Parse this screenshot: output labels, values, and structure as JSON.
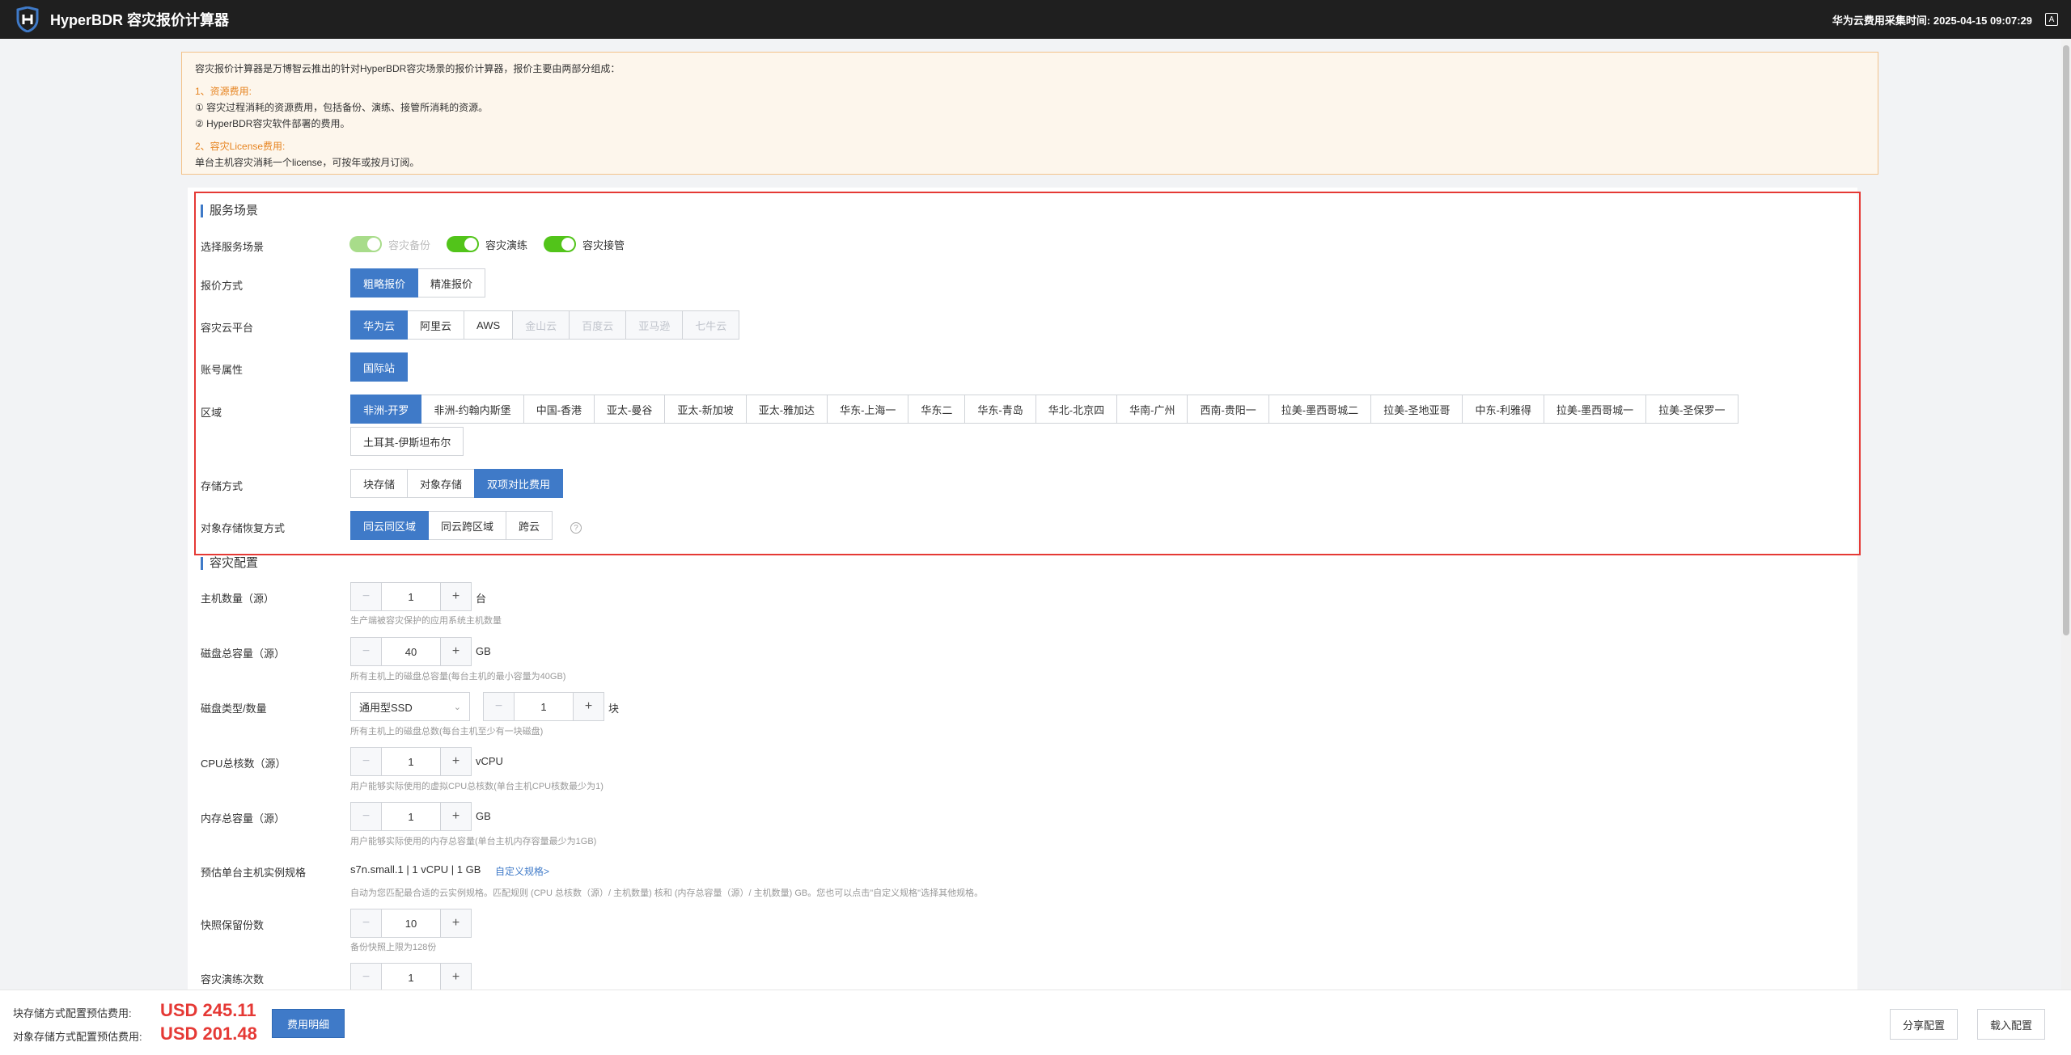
{
  "header": {
    "title": "HyperBDR 容灾报价计算器",
    "collect_time": "华为云费用采集时间: 2025-04-15 09:07:29",
    "corner_icon": "A"
  },
  "notice": {
    "intro": "容灾报价计算器是万博智云推出的针对HyperBDR容灾场景的报价计算器，报价主要由两部分组成：",
    "section1_title": "1、资源费用:",
    "section1_item1": "① 容灾过程消耗的资源费用，包括备份、演练、接管所消耗的资源。",
    "section1_item2": "② HyperBDR容灾软件部署的费用。",
    "section2_title": "2、容灾License费用:",
    "section2_item1": "单台主机容灾消耗一个license，可按年或按月订阅。"
  },
  "service": {
    "section_title": "服务场景",
    "scene_label": "选择服务场景",
    "toggles": [
      {
        "label": "容灾备份",
        "on": true,
        "disabled": true
      },
      {
        "label": "容灾演练",
        "on": true,
        "disabled": false
      },
      {
        "label": "容灾接管",
        "on": true,
        "disabled": false
      }
    ],
    "quote_label": "报价方式",
    "quote_options": [
      "粗略报价",
      "精准报价"
    ],
    "cloud_label": "容灾云平台",
    "cloud_options": [
      "华为云",
      "阿里云",
      "AWS",
      "金山云",
      "百度云",
      "亚马逊",
      "七牛云"
    ],
    "account_label": "账号属性",
    "account_options": [
      "国际站"
    ],
    "region_label": "区域",
    "region_options": [
      "非洲-开罗",
      "非洲-约翰内斯堡",
      "中国-香港",
      "亚太-曼谷",
      "亚太-新加坡",
      "亚太-雅加达",
      "华东-上海一",
      "华东二",
      "华东-青岛",
      "华北-北京四",
      "华南-广州",
      "西南-贵阳一",
      "拉美-墨西哥城二",
      "拉美-圣地亚哥",
      "中东-利雅得",
      "拉美-墨西哥城一",
      "拉美-圣保罗一"
    ],
    "region_options_row2": [
      "土耳其-伊斯坦布尔"
    ],
    "storage_label": "存储方式",
    "storage_options": [
      "块存储",
      "对象存储",
      "双项对比费用"
    ],
    "recovery_label": "对象存储恢复方式",
    "recovery_options": [
      "同云同区域",
      "同云跨区域",
      "跨云"
    ],
    "help_icon": "?"
  },
  "config": {
    "section_title": "容灾配置",
    "hosts": {
      "label": "主机数量（源）",
      "value": "1",
      "unit": "台",
      "hint": "生产端被容灾保护的应用系统主机数量"
    },
    "disk_capacity": {
      "label": "磁盘总容量（源）",
      "value": "40",
      "unit": "GB",
      "hint": "所有主机上的磁盘总容量(每台主机的最小容量为40GB)"
    },
    "disk_type": {
      "label": "磁盘类型/数量",
      "select": "通用型SSD",
      "value": "1",
      "unit": "块",
      "hint": "所有主机上的磁盘总数(每台主机至少有一块磁盘)"
    },
    "cpu": {
      "label": "CPU总核数（源）",
      "value": "1",
      "unit": "vCPU",
      "hint": "用户能够实际使用的虚拟CPU总核数(单台主机CPU核数最少为1)"
    },
    "memory": {
      "label": "内存总容量（源）",
      "value": "1",
      "unit": "GB",
      "hint": "用户能够实际使用的内存总容量(单台主机内存容量最少为1GB)"
    },
    "spec": {
      "label": "预估单台主机实例规格",
      "value": "s7n.small.1 | 1 vCPU | 1 GB",
      "link": "自定义规格>",
      "hint": "自动为您匹配最合适的云实例规格。匹配规则 (CPU 总核数（源）/ 主机数量) 核和 (内存总容量（源）/ 主机数量) GB。您也可以点击\"自定义规格\"选择其他规格。"
    },
    "snapshots": {
      "label": "快照保留份数",
      "value": "10",
      "hint": "备份快照上限为128份"
    },
    "drills": {
      "label": "容灾演练次数",
      "value": "1"
    }
  },
  "footer": {
    "block_label": "块存储方式配置预估费用:",
    "block_value": "USD 245.11",
    "object_label": "对象存储方式配置预估费用:",
    "object_value": "USD 201.48",
    "detail_button": "费用明细",
    "share_button": "分享配置",
    "load_button": "载入配置"
  },
  "colors": {
    "primary": "#3f7ac8",
    "danger": "#e53935",
    "toggle_on": "#52c41a",
    "notice_bg": "#fdf6ec",
    "notice_orange": "#e6831f"
  },
  "icons": [
    "shield-logo-icon",
    "corner-icon",
    "minus-icon",
    "plus-icon",
    "chevron-down-icon",
    "help-icon"
  ]
}
